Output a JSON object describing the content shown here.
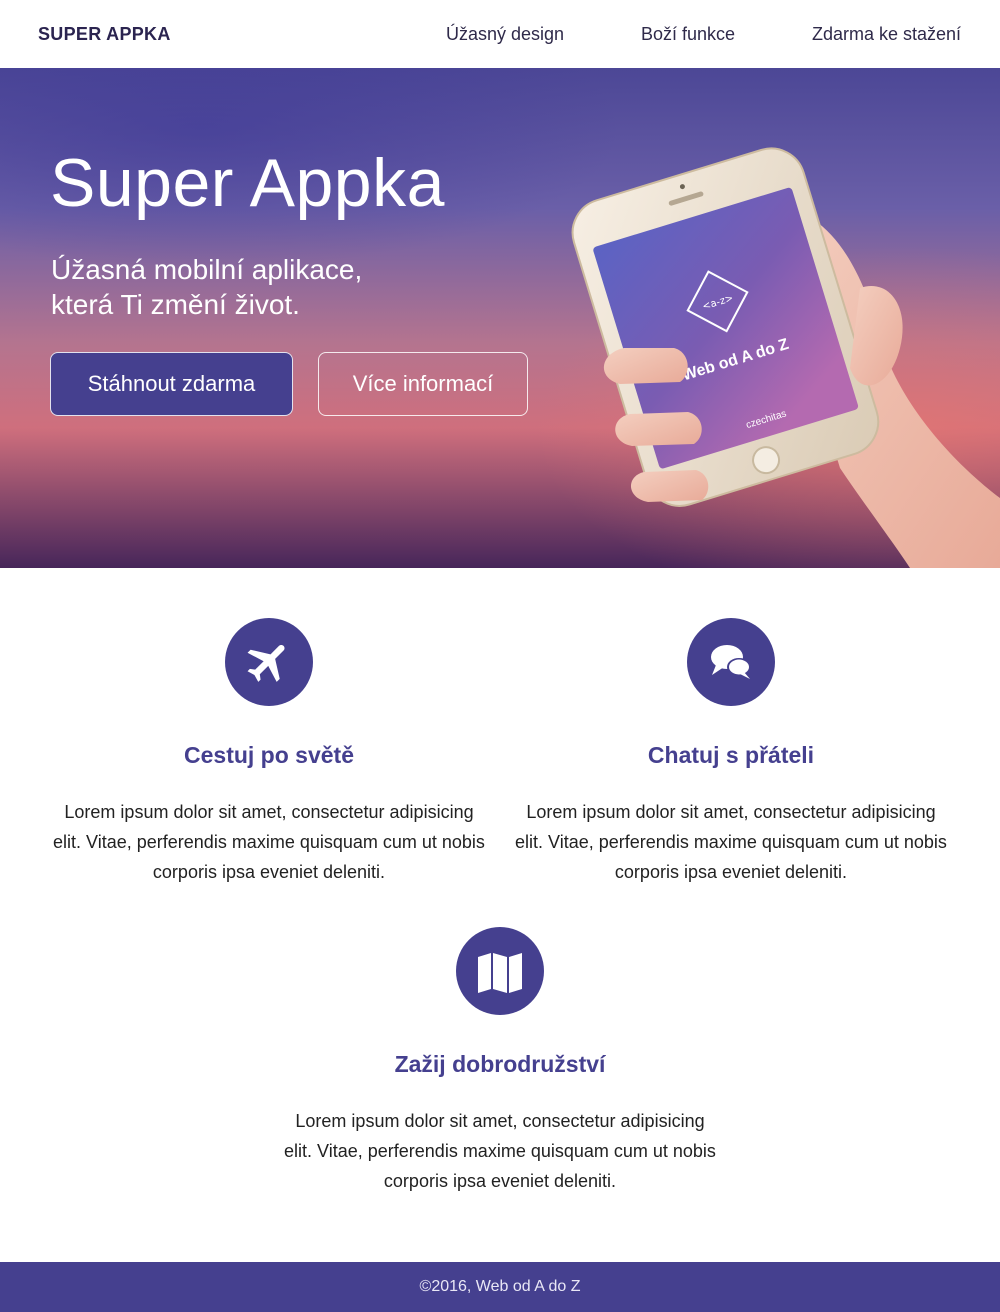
{
  "nav": {
    "brand": "SUPER APPKA",
    "links": [
      "Úžasný design",
      "Boží funkce",
      "Zdarma ke stažení"
    ]
  },
  "hero": {
    "title": "Super Appka",
    "subtitle_line1": "Úžasná mobilní aplikace,",
    "subtitle_line2": "která Ti změní život.",
    "primary_button": "Stáhnout zdarma",
    "secondary_button": "Více informací",
    "phone_screen_title": "Web od A do Z",
    "phone_screen_logo": "<a-z>",
    "phone_screen_brand": "czechitas"
  },
  "features": [
    {
      "icon": "airplane-icon",
      "title": "Cestuj po světě",
      "text": "Lorem ipsum dolor sit amet, consectetur adipisicing elit. Vitae, perferendis maxime quisquam cum ut nobis corporis ipsa eveniet deleniti."
    },
    {
      "icon": "chat-bubbles-icon",
      "title": "Chatuj s přáteli",
      "text": "Lorem ipsum dolor sit amet, consectetur adipisicing elit. Vitae, perferendis maxime quisquam cum ut nobis corporis ipsa eveniet deleniti."
    },
    {
      "icon": "map-icon",
      "title": "Zažij dobrodružství",
      "text": "Lorem ipsum dolor sit amet, consectetur adipisicing elit. Vitae, perferendis maxime quisquam cum ut nobis corporis ipsa eveniet deleniti."
    }
  ],
  "footer": {
    "text": "©2016, Web od A do Z"
  },
  "colors": {
    "accent": "#45408f",
    "footer_text": "#e9e7f6",
    "hero_gradient_top": "#4c4796",
    "hero_gradient_mid": "#cf6f7d",
    "hero_gradient_bottom": "#47265a"
  }
}
